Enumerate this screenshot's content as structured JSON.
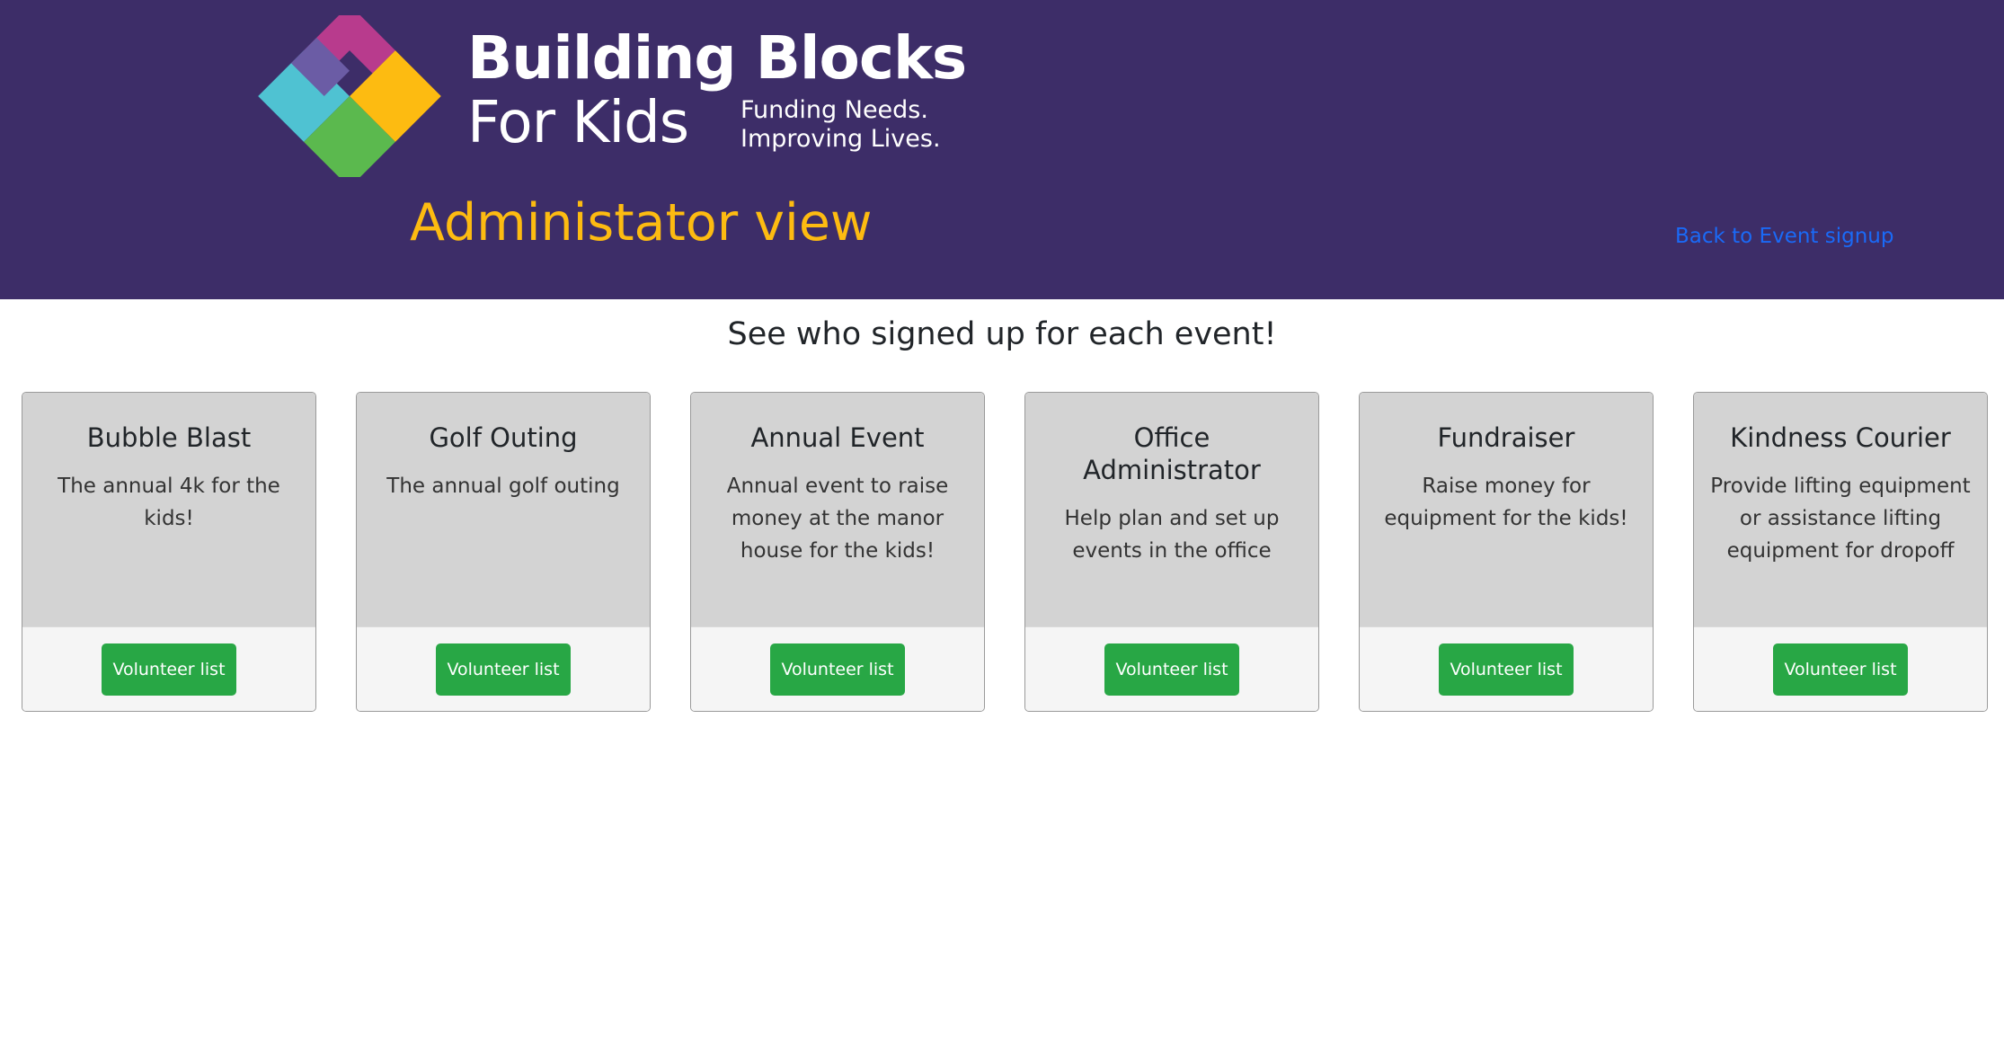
{
  "header": {
    "logo": {
      "name_line1": "Building Blocks",
      "name_line2": "For Kids",
      "tagline_line1": "Funding Needs.",
      "tagline_line2": "Improving Lives."
    },
    "title": "Administator view",
    "back_link": "Back to Event signup"
  },
  "colors": {
    "header_bg": "#3d2d68",
    "title": "#fdbb11",
    "link": "#1a6af7",
    "button": "#28a745",
    "card_body": "#d3d3d3",
    "logo_magenta": "#b83b8d",
    "logo_yellow": "#fdbb11",
    "logo_purple": "#6b5ca5",
    "logo_green": "#5bb94e",
    "logo_cyan": "#4fc2d2"
  },
  "main": {
    "subtitle": "See who signed up for each event!",
    "cards": [
      {
        "title": "Bubble Blast",
        "description": "The annual 4k for the kids!",
        "button": "Volunteer list"
      },
      {
        "title": "Golf Outing",
        "description": "The annual golf outing",
        "button": "Volunteer list"
      },
      {
        "title": "Annual Event",
        "description": "Annual event to raise money at the manor house for the kids!",
        "button": "Volunteer list"
      },
      {
        "title": "Office Administrator",
        "description": "Help plan and set up events in the office",
        "button": "Volunteer list"
      },
      {
        "title": "Fundraiser",
        "description": "Raise money for equipment for the kids!",
        "button": "Volunteer list"
      },
      {
        "title": "Kindness Courier",
        "description": "Provide lifting equipment or assistance lifting equipment for dropoff",
        "button": "Volunteer list"
      }
    ]
  }
}
